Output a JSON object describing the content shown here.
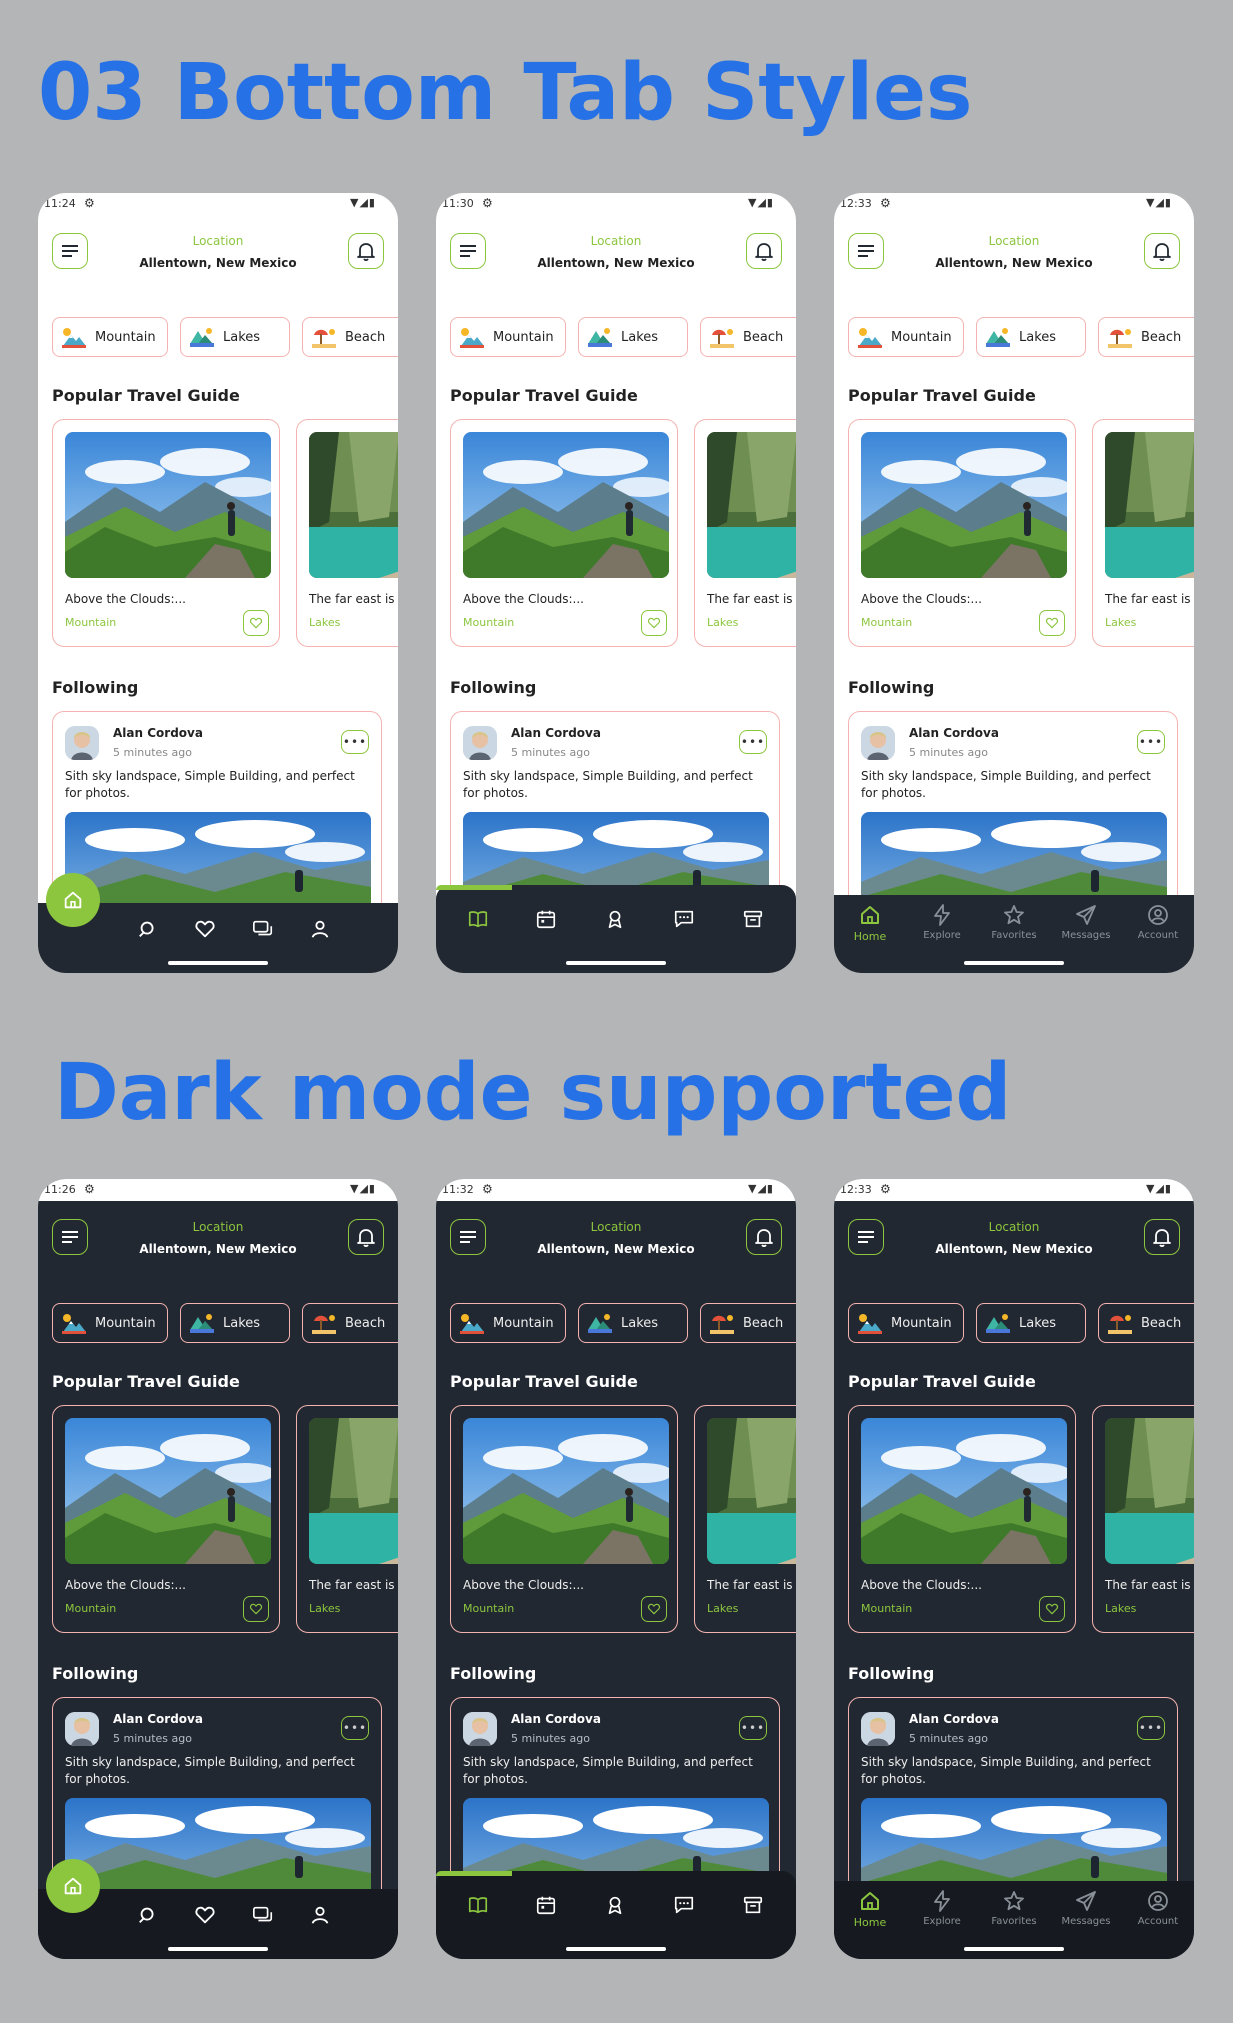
{
  "headings": {
    "top": "03 Bottom Tab Styles",
    "bottom": "Dark mode supported"
  },
  "colors": {
    "accent": "#8cc63f",
    "headline": "#2771e6",
    "card_border": "#f4b3b0",
    "dark_bg": "#222831"
  },
  "phones": [
    {
      "theme": "light",
      "time": "11:24",
      "nav_style": 1
    },
    {
      "theme": "light",
      "time": "11:30",
      "nav_style": 2
    },
    {
      "theme": "light",
      "time": "12:33",
      "nav_style": 3
    },
    {
      "theme": "dark",
      "time": "11:26",
      "nav_style": 1
    },
    {
      "theme": "dark",
      "time": "11:32",
      "nav_style": 2
    },
    {
      "theme": "dark",
      "time": "12:33",
      "nav_style": 3
    }
  ],
  "header": {
    "location_label": "Location",
    "location_value": "Allentown, New Mexico"
  },
  "categories": [
    "Mountain",
    "Lakes",
    "Beach"
  ],
  "popular": {
    "title": "Popular Travel Guide",
    "cards": [
      {
        "title": "Above the Clouds:...",
        "category": "Mountain"
      },
      {
        "title": "The far east is",
        "category": "Lakes"
      }
    ]
  },
  "following": {
    "title": "Following",
    "post": {
      "author": "Alan Cordova",
      "time": "5 minutes ago",
      "text": "Sith sky landspace, Simple Building, and perfect for photos."
    }
  },
  "nav_style_1": {
    "icons": [
      "home-icon",
      "search-icon",
      "heart-icon",
      "chat-icon",
      "user-icon"
    ]
  },
  "nav_style_2": {
    "icons": [
      "book-icon",
      "calendar-icon",
      "award-icon",
      "message-icon",
      "archive-icon"
    ]
  },
  "nav_style_3": {
    "items": [
      {
        "label": "Home",
        "icon": "home-icon"
      },
      {
        "label": "Explore",
        "icon": "lightning-icon"
      },
      {
        "label": "Favorites",
        "icon": "star-icon"
      },
      {
        "label": "Messages",
        "icon": "send-icon"
      },
      {
        "label": "Account",
        "icon": "account-icon"
      }
    ]
  }
}
